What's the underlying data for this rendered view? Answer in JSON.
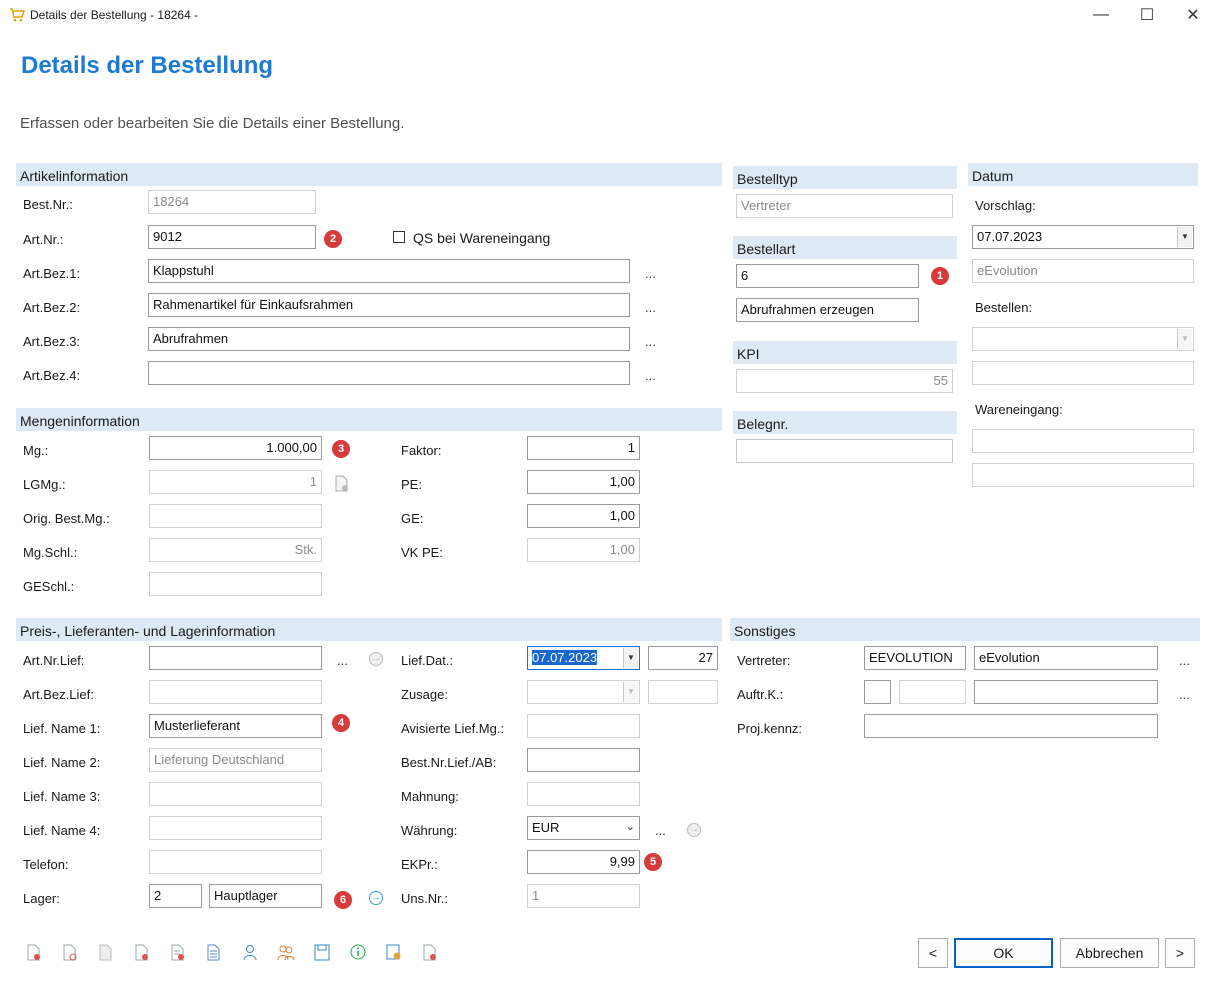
{
  "window": {
    "title": "Details der Bestellung - 18264 -",
    "min": "—",
    "max": "☐",
    "close": "✕"
  },
  "header": {
    "title": "Details der Bestellung",
    "subtitle": "Erfassen oder bearbeiten Sie die Details einer Bestellung."
  },
  "artikel": {
    "section": "Artikelinformation",
    "bestnr_label": "Best.Nr.:",
    "bestnr": "18264",
    "artnr_label": "Art.Nr.:",
    "artnr": "9012",
    "qs_label": "QS bei Wareneingang",
    "bez1_label": "Art.Bez.1:",
    "bez1": "Klappstuhl",
    "bez2_label": "Art.Bez.2:",
    "bez2": "Rahmenartikel für Einkaufsrahmen",
    "bez3_label": "Art.Bez.3:",
    "bez3": "Abrufrahmen",
    "bez4_label": "Art.Bez.4:",
    "bez4": ""
  },
  "bestelltyp": {
    "section": "Bestelltyp",
    "value": "Vertreter"
  },
  "bestellart": {
    "section": "Bestellart",
    "code": "6",
    "text": "Abrufrahmen erzeugen"
  },
  "kpi": {
    "section": "KPI",
    "value": "55"
  },
  "belegnr": {
    "section": "Belegnr.",
    "value": ""
  },
  "datum": {
    "section": "Datum",
    "vorschlag_label": "Vorschlag:",
    "vorschlag_date": "07.07.2023",
    "vorschlag_user": "eEvolution",
    "bestellen_label": "Bestellen:",
    "wareneingang_label": "Wareneingang:"
  },
  "menge": {
    "section": "Mengeninformation",
    "mg_label": "Mg.:",
    "mg": "1.000,00",
    "lgmg_label": "LGMg.:",
    "lgmg": "1",
    "orig_label": "Orig. Best.Mg.:",
    "orig": "",
    "mgschl_label": "Mg.Schl.:",
    "mgschl": "Stk.",
    "geschl_label": "GESchl.:",
    "geschl": "",
    "faktor_label": "Faktor:",
    "faktor": "1",
    "pe_label": "PE:",
    "pe": "1,00",
    "ge_label": "GE:",
    "ge": "1,00",
    "vkpe_label": "VK PE:",
    "vkpe": "1,00"
  },
  "preis": {
    "section": "Preis-, Lieferanten- und Lagerinformation",
    "artnrlief_label": "Art.Nr.Lief:",
    "artnrlief": "",
    "artbezlief_label": "Art.Bez.Lief:",
    "artbezlief": "",
    "name1_label": "Lief. Name 1:",
    "name1": "Musterlieferant",
    "name2_label": "Lief. Name 2:",
    "name2": "Lieferung Deutschland",
    "name3_label": "Lief. Name 3:",
    "name3": "",
    "name4_label": "Lief. Name 4:",
    "name4": "",
    "telefon_label": "Telefon:",
    "telefon": "",
    "lager_label": "Lager:",
    "lager_nr": "2",
    "lager_name": "Hauptlager",
    "liefdat_label": "Lief.Dat.:",
    "liefdat": "07.07.2023",
    "liefdat_kw": "27",
    "zusage_label": "Zusage:",
    "avis_label": "Avisierte Lief.Mg.:",
    "bestnrlief_label": "Best.Nr.Lief./AB:",
    "mahnung_label": "Mahnung:",
    "waehrung_label": "Währung:",
    "waehrung": "EUR",
    "ekpr_label": "EKPr.:",
    "ekpr": "9,99",
    "unsnr_label": "Uns.Nr.:",
    "unsnr": "1"
  },
  "sonstiges": {
    "section": "Sonstiges",
    "vertreter_label": "Vertreter:",
    "vertreter_code": "EEVOLUTION",
    "vertreter_name": "eEvolution",
    "auftrk_label": "Auftr.K.:",
    "projkennz_label": "Proj.kennz:"
  },
  "badges": [
    "1",
    "2",
    "3",
    "4",
    "5",
    "6"
  ],
  "ellipsis": "...",
  "buttons": {
    "prev": "<",
    "ok": "OK",
    "cancel": "Abbrechen",
    "next": ">"
  },
  "colors": {
    "accent": "#1f7ad1",
    "section_bg": "#dde9f4",
    "badge": "#d93a3a",
    "selection": "#1a67d2"
  }
}
